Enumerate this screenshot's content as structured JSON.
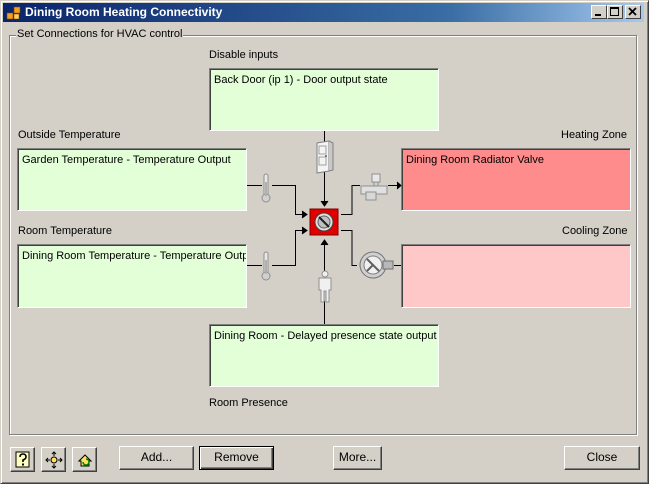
{
  "window": {
    "title": "Dining Room Heating Connectivity"
  },
  "group": {
    "label": "Set Connections for HVAC control"
  },
  "disable_inputs": {
    "label": "Disable inputs",
    "value": "Back Door (ip 1) - Door output state"
  },
  "outside_temperature": {
    "label": "Outside Temperature",
    "value": "Garden Temperature - Temperature Output"
  },
  "room_temperature": {
    "label": "Room Temperature",
    "value": "Dining Room Temperature - Temperature Output"
  },
  "room_presence": {
    "label": "Room Presence",
    "value": "Dining Room - Delayed presence state output"
  },
  "heating_zone": {
    "label": "Heating Zone",
    "value": "Dining Room Radiator Valve",
    "color": "#ff8c8c"
  },
  "cooling_zone": {
    "label": "Cooling Zone",
    "value": "",
    "color": "#ffc8c8"
  },
  "buttons": {
    "add": "Add...",
    "remove": "Remove",
    "more": "More...",
    "close": "Close"
  },
  "icons": {
    "help": "help-icon",
    "network": "network-icon",
    "refresh": "refresh-icon",
    "door": "door-icon",
    "thermometer": "thermometer-icon",
    "controller": "controller-icon",
    "valve": "valve-icon",
    "fan": "fan-icon",
    "person": "person-icon"
  }
}
